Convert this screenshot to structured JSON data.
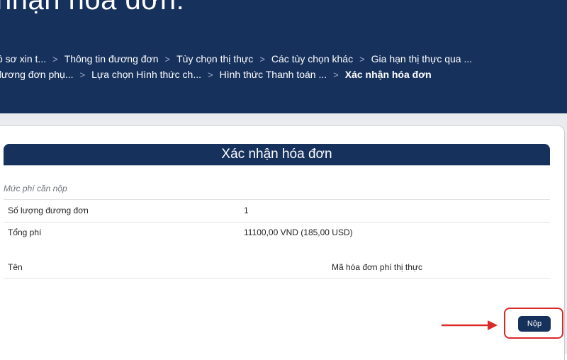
{
  "header": {
    "title": "nhận hóa đơn:",
    "breadcrumb_row1": [
      "ồ sơ xin t...",
      "Thông tin đương đơn",
      "Tùy chọn thị thực",
      "Các tùy chọn khác",
      "Gia hạn thị thực qua ..."
    ],
    "breadcrumb_row2": [
      "đương đơn phụ...",
      "Lựa chọn Hình thức ch...",
      "Hình thức Thanh toán ...",
      "Xác nhận hóa đơn"
    ],
    "separator": ">"
  },
  "card": {
    "title": "Xác nhận hóa đơn",
    "section_label": "Mức phí cần nộp",
    "rows": [
      {
        "label": "Số lượng đương đơn",
        "value": "1"
      },
      {
        "label": "Tổng phí",
        "value": "11100,00 VND (185,00 USD)"
      }
    ],
    "name_column": "Tên",
    "invoice_column": "Mã hóa đơn phí thị thực",
    "submit_label": "Nộp"
  },
  "colors": {
    "header_bg": "#17315d",
    "accent_red": "#d92a2a",
    "page_bg": "#e9ebef"
  },
  "icons": {
    "annotation_arrow": "right-arrow-icon"
  }
}
